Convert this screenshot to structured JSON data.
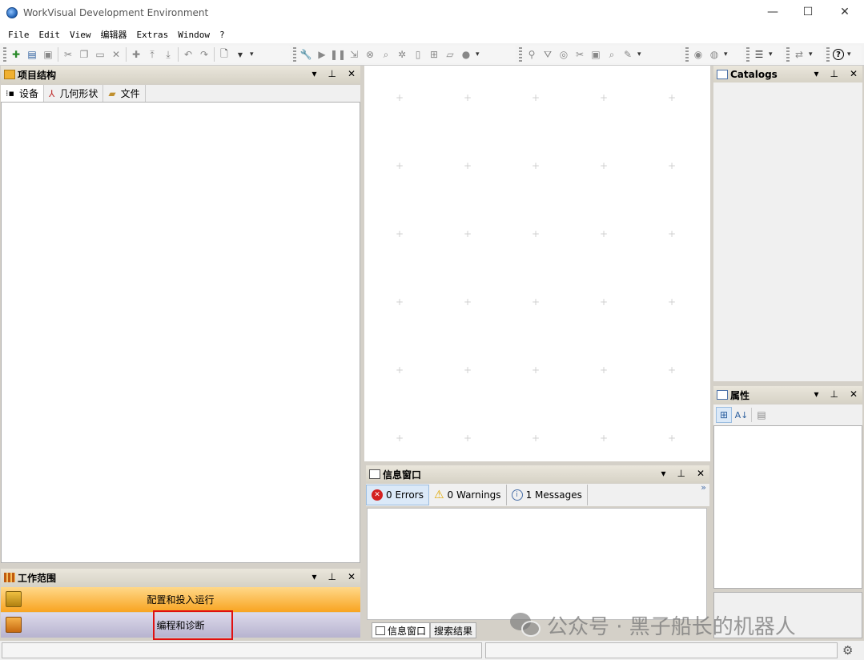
{
  "window": {
    "title": "WorkVisual Development Environment",
    "controls": {
      "minimize": "—",
      "maximize": "☐",
      "close": "✕"
    }
  },
  "menu": [
    "File",
    "Edit",
    "View",
    "编辑器",
    "Extras",
    "Window",
    "?"
  ],
  "project_structure": {
    "title": "项目结构",
    "tabs": [
      {
        "label": "设备",
        "icon": "devices-icon",
        "active": true
      },
      {
        "label": "几何形状",
        "icon": "axes-icon",
        "active": false
      },
      {
        "label": "文件",
        "icon": "files-icon",
        "active": false
      }
    ]
  },
  "workspace": {
    "title": "工作范围",
    "items": [
      {
        "label": "配置和投入运行",
        "icon": "config-commissioning-icon"
      },
      {
        "label": "编程和诊断",
        "icon": "programming-diagnosis-icon",
        "highlighted": true
      }
    ]
  },
  "catalogs": {
    "title": "Catalogs"
  },
  "properties": {
    "title": "属性"
  },
  "message_window": {
    "title": "信息窗口",
    "filters": [
      {
        "label": "0 Errors",
        "icon": "error-icon",
        "active": true
      },
      {
        "label": "0 Warnings",
        "icon": "warning-icon",
        "active": false
      },
      {
        "label": "1 Messages",
        "icon": "info-icon",
        "active": false
      }
    ],
    "bottom_tabs": [
      {
        "label": "信息窗口",
        "active": true
      },
      {
        "label": "搜索结果",
        "active": false
      }
    ],
    "overflow": "»"
  },
  "watermark": {
    "text": "公众号 · 黑子船长的机器人"
  },
  "colors": {
    "accent_orange": "#f8a421",
    "highlight_red": "#e01010",
    "panel_header": "#d6d2c6"
  }
}
